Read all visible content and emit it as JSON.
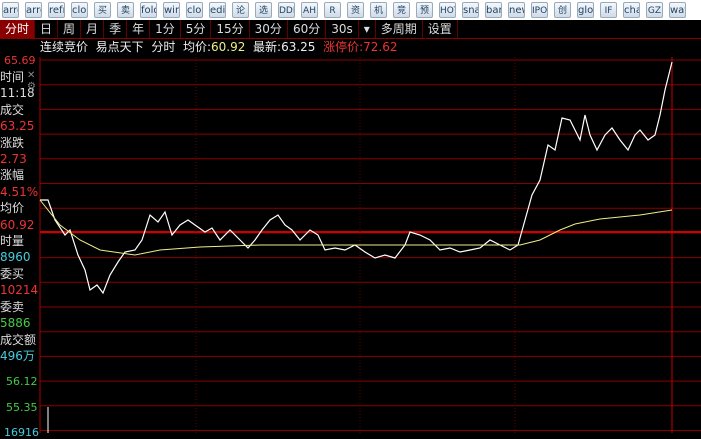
{
  "toolbar": {
    "icons": [
      "arrow-up",
      "arrow-down",
      "refresh",
      "clock",
      "买",
      "卖",
      "folder",
      "window",
      "clock2",
      "edit",
      "论",
      "选",
      "DDE",
      "AH",
      "R",
      "资",
      "机",
      "竞",
      "预",
      "HOT",
      "snake",
      "bank",
      "news",
      "IPO",
      "创",
      "globe",
      "IF",
      "chart",
      "GZ",
      "wave"
    ]
  },
  "tabs": [
    "分时",
    "日",
    "周",
    "月",
    "季",
    "年",
    "1分",
    "5分",
    "15分",
    "30分",
    "60分",
    "30s",
    "▾",
    "多周期",
    "设置"
  ],
  "info": {
    "auction": "连续竞价",
    "source": "易点天下",
    "mode": "分时",
    "avg_label": "均价:",
    "avg": "60.92",
    "last_label": "最新:",
    "last": "63.25",
    "limit_label": "涨停价:",
    "limit": "72.62"
  },
  "axis": {
    "top": "65.69",
    "lower1": "56.12",
    "lower2": "55.35",
    "bottom": "16916"
  },
  "panel": [
    {
      "t": "时间",
      "c": "lbl"
    },
    {
      "t": "11:18",
      "c": "lbl"
    },
    {
      "t": "成交",
      "c": "lbl"
    },
    {
      "t": "63.25",
      "c": "red"
    },
    {
      "t": "涨跌",
      "c": "lbl"
    },
    {
      "t": "2.73",
      "c": "red"
    },
    {
      "t": "涨幅",
      "c": "lbl"
    },
    {
      "t": "4.51%",
      "c": "red"
    },
    {
      "t": "均价",
      "c": "lbl"
    },
    {
      "t": "60.92",
      "c": "red"
    },
    {
      "t": "时量",
      "c": "lbl"
    },
    {
      "t": "8960",
      "c": "cyan"
    },
    {
      "t": "委买",
      "c": "lbl"
    },
    {
      "t": "10214",
      "c": "red"
    },
    {
      "t": "委卖",
      "c": "lbl"
    },
    {
      "t": "5886",
      "c": "grn"
    },
    {
      "t": "成交额",
      "c": "lbl"
    },
    {
      "t": "496万",
      "c": "cyan"
    }
  ],
  "chart_data": {
    "type": "line",
    "series": [
      {
        "name": "price"
      },
      {
        "name": "average"
      }
    ]
  }
}
